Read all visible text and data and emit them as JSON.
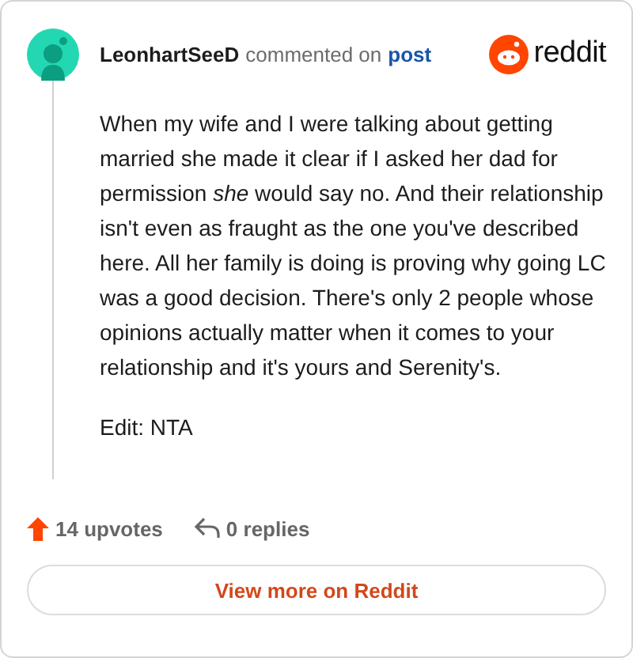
{
  "comment": {
    "author": "LeonhartSeeD",
    "action": "commented on",
    "link": "post"
  },
  "brand": {
    "name": "reddit"
  },
  "body": [
    "When my wife and I were talking about getting married she made it clear if I asked her dad for permission *she* would say no. And their relationship isn't even as fraught as the one you've described here. All her family is doing is proving why going LC was a good decision. There's only 2 people whose opinions actually matter when it comes to your relationship and it's yours and Serenity's.",
    "Edit: NTA"
  ],
  "footer": {
    "upvotes": "14 upvotes",
    "replies": "0 replies"
  },
  "button": "View more on Reddit"
}
